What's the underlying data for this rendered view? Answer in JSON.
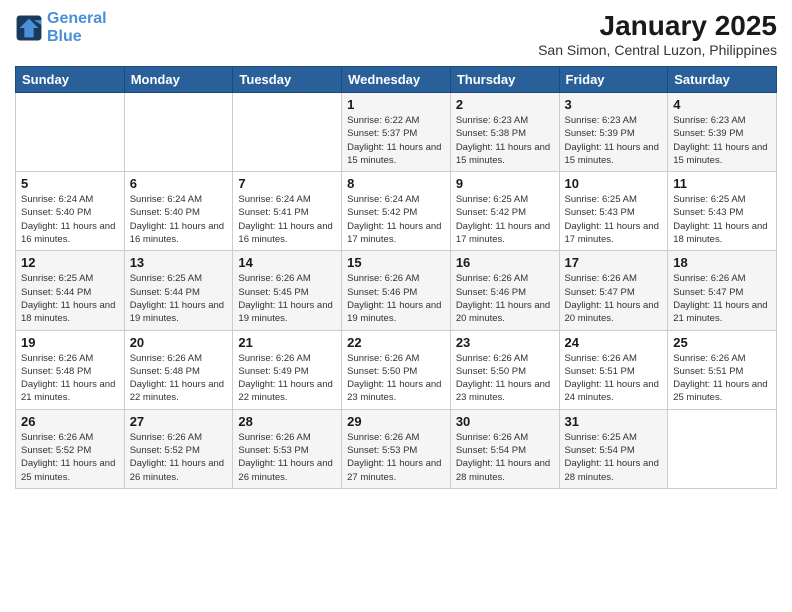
{
  "logo": {
    "line1": "General",
    "line2": "Blue"
  },
  "title": "January 2025",
  "subtitle": "San Simon, Central Luzon, Philippines",
  "weekdays": [
    "Sunday",
    "Monday",
    "Tuesday",
    "Wednesday",
    "Thursday",
    "Friday",
    "Saturday"
  ],
  "weeks": [
    [
      {
        "day": "",
        "sunrise": "",
        "sunset": "",
        "daylight": ""
      },
      {
        "day": "",
        "sunrise": "",
        "sunset": "",
        "daylight": ""
      },
      {
        "day": "",
        "sunrise": "",
        "sunset": "",
        "daylight": ""
      },
      {
        "day": "1",
        "sunrise": "Sunrise: 6:22 AM",
        "sunset": "Sunset: 5:37 PM",
        "daylight": "Daylight: 11 hours and 15 minutes."
      },
      {
        "day": "2",
        "sunrise": "Sunrise: 6:23 AM",
        "sunset": "Sunset: 5:38 PM",
        "daylight": "Daylight: 11 hours and 15 minutes."
      },
      {
        "day": "3",
        "sunrise": "Sunrise: 6:23 AM",
        "sunset": "Sunset: 5:39 PM",
        "daylight": "Daylight: 11 hours and 15 minutes."
      },
      {
        "day": "4",
        "sunrise": "Sunrise: 6:23 AM",
        "sunset": "Sunset: 5:39 PM",
        "daylight": "Daylight: 11 hours and 15 minutes."
      }
    ],
    [
      {
        "day": "5",
        "sunrise": "Sunrise: 6:24 AM",
        "sunset": "Sunset: 5:40 PM",
        "daylight": "Daylight: 11 hours and 16 minutes."
      },
      {
        "day": "6",
        "sunrise": "Sunrise: 6:24 AM",
        "sunset": "Sunset: 5:40 PM",
        "daylight": "Daylight: 11 hours and 16 minutes."
      },
      {
        "day": "7",
        "sunrise": "Sunrise: 6:24 AM",
        "sunset": "Sunset: 5:41 PM",
        "daylight": "Daylight: 11 hours and 16 minutes."
      },
      {
        "day": "8",
        "sunrise": "Sunrise: 6:24 AM",
        "sunset": "Sunset: 5:42 PM",
        "daylight": "Daylight: 11 hours and 17 minutes."
      },
      {
        "day": "9",
        "sunrise": "Sunrise: 6:25 AM",
        "sunset": "Sunset: 5:42 PM",
        "daylight": "Daylight: 11 hours and 17 minutes."
      },
      {
        "day": "10",
        "sunrise": "Sunrise: 6:25 AM",
        "sunset": "Sunset: 5:43 PM",
        "daylight": "Daylight: 11 hours and 17 minutes."
      },
      {
        "day": "11",
        "sunrise": "Sunrise: 6:25 AM",
        "sunset": "Sunset: 5:43 PM",
        "daylight": "Daylight: 11 hours and 18 minutes."
      }
    ],
    [
      {
        "day": "12",
        "sunrise": "Sunrise: 6:25 AM",
        "sunset": "Sunset: 5:44 PM",
        "daylight": "Daylight: 11 hours and 18 minutes."
      },
      {
        "day": "13",
        "sunrise": "Sunrise: 6:25 AM",
        "sunset": "Sunset: 5:44 PM",
        "daylight": "Daylight: 11 hours and 19 minutes."
      },
      {
        "day": "14",
        "sunrise": "Sunrise: 6:26 AM",
        "sunset": "Sunset: 5:45 PM",
        "daylight": "Daylight: 11 hours and 19 minutes."
      },
      {
        "day": "15",
        "sunrise": "Sunrise: 6:26 AM",
        "sunset": "Sunset: 5:46 PM",
        "daylight": "Daylight: 11 hours and 19 minutes."
      },
      {
        "day": "16",
        "sunrise": "Sunrise: 6:26 AM",
        "sunset": "Sunset: 5:46 PM",
        "daylight": "Daylight: 11 hours and 20 minutes."
      },
      {
        "day": "17",
        "sunrise": "Sunrise: 6:26 AM",
        "sunset": "Sunset: 5:47 PM",
        "daylight": "Daylight: 11 hours and 20 minutes."
      },
      {
        "day": "18",
        "sunrise": "Sunrise: 6:26 AM",
        "sunset": "Sunset: 5:47 PM",
        "daylight": "Daylight: 11 hours and 21 minutes."
      }
    ],
    [
      {
        "day": "19",
        "sunrise": "Sunrise: 6:26 AM",
        "sunset": "Sunset: 5:48 PM",
        "daylight": "Daylight: 11 hours and 21 minutes."
      },
      {
        "day": "20",
        "sunrise": "Sunrise: 6:26 AM",
        "sunset": "Sunset: 5:48 PM",
        "daylight": "Daylight: 11 hours and 22 minutes."
      },
      {
        "day": "21",
        "sunrise": "Sunrise: 6:26 AM",
        "sunset": "Sunset: 5:49 PM",
        "daylight": "Daylight: 11 hours and 22 minutes."
      },
      {
        "day": "22",
        "sunrise": "Sunrise: 6:26 AM",
        "sunset": "Sunset: 5:50 PM",
        "daylight": "Daylight: 11 hours and 23 minutes."
      },
      {
        "day": "23",
        "sunrise": "Sunrise: 6:26 AM",
        "sunset": "Sunset: 5:50 PM",
        "daylight": "Daylight: 11 hours and 23 minutes."
      },
      {
        "day": "24",
        "sunrise": "Sunrise: 6:26 AM",
        "sunset": "Sunset: 5:51 PM",
        "daylight": "Daylight: 11 hours and 24 minutes."
      },
      {
        "day": "25",
        "sunrise": "Sunrise: 6:26 AM",
        "sunset": "Sunset: 5:51 PM",
        "daylight": "Daylight: 11 hours and 25 minutes."
      }
    ],
    [
      {
        "day": "26",
        "sunrise": "Sunrise: 6:26 AM",
        "sunset": "Sunset: 5:52 PM",
        "daylight": "Daylight: 11 hours and 25 minutes."
      },
      {
        "day": "27",
        "sunrise": "Sunrise: 6:26 AM",
        "sunset": "Sunset: 5:52 PM",
        "daylight": "Daylight: 11 hours and 26 minutes."
      },
      {
        "day": "28",
        "sunrise": "Sunrise: 6:26 AM",
        "sunset": "Sunset: 5:53 PM",
        "daylight": "Daylight: 11 hours and 26 minutes."
      },
      {
        "day": "29",
        "sunrise": "Sunrise: 6:26 AM",
        "sunset": "Sunset: 5:53 PM",
        "daylight": "Daylight: 11 hours and 27 minutes."
      },
      {
        "day": "30",
        "sunrise": "Sunrise: 6:26 AM",
        "sunset": "Sunset: 5:54 PM",
        "daylight": "Daylight: 11 hours and 28 minutes."
      },
      {
        "day": "31",
        "sunrise": "Sunrise: 6:25 AM",
        "sunset": "Sunset: 5:54 PM",
        "daylight": "Daylight: 11 hours and 28 minutes."
      },
      {
        "day": "",
        "sunrise": "",
        "sunset": "",
        "daylight": ""
      }
    ]
  ]
}
